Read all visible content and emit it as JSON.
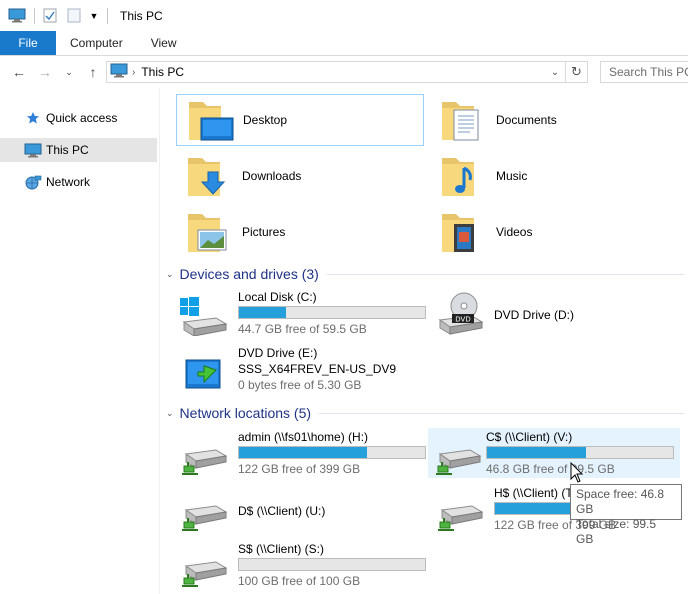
{
  "window": {
    "title": "This PC"
  },
  "ribbon": {
    "tabs": [
      "File",
      "Computer",
      "View"
    ]
  },
  "address": {
    "path": "This PC",
    "search_placeholder": "Search This PC"
  },
  "nav": {
    "items": [
      "Quick access",
      "This PC",
      "Network"
    ],
    "selected": "This PC"
  },
  "folders": [
    "Desktop",
    "Documents",
    "Downloads",
    "Music",
    "Pictures",
    "Videos"
  ],
  "groups": {
    "devices": "Devices and drives (3)",
    "network": "Network locations (5)"
  },
  "devices": [
    {
      "name": "Local Disk (C:)",
      "free": "44.7 GB free of 59.5 GB",
      "used_fraction": 0.25
    },
    {
      "name": "DVD Drive (D:)"
    },
    {
      "name": "DVD Drive (E:)",
      "label": "SSS_X64FREV_EN-US_DV9",
      "free": "0 bytes free of 5.30 GB"
    }
  ],
  "network": [
    {
      "name": "admin (\\\\fs01\\home) (H:)",
      "free": "122 GB free of 399 GB",
      "used_fraction": 0.69
    },
    {
      "name": "C$ (\\\\Client) (V:)",
      "free": "46.8 GB free of 99.5 GB",
      "used_fraction": 0.53
    },
    {
      "name": "D$ (\\\\Client) (U:)"
    },
    {
      "name": "H$ (\\\\Client) (T:)",
      "free": "122 GB free of 399 GB",
      "used_fraction": 0.69
    },
    {
      "name": "S$ (\\\\Client) (S:)",
      "free": "100 GB free of 100 GB",
      "used_fraction": 0.0
    }
  ],
  "tooltip": {
    "space_free": "Space free: 46.8 GB",
    "total_size": "Total size: 99.5 GB"
  },
  "colors": {
    "accent": "#1979ca",
    "bar": "#26a0da",
    "group_title": "#1e3287",
    "hover": "#e5f3ff"
  }
}
